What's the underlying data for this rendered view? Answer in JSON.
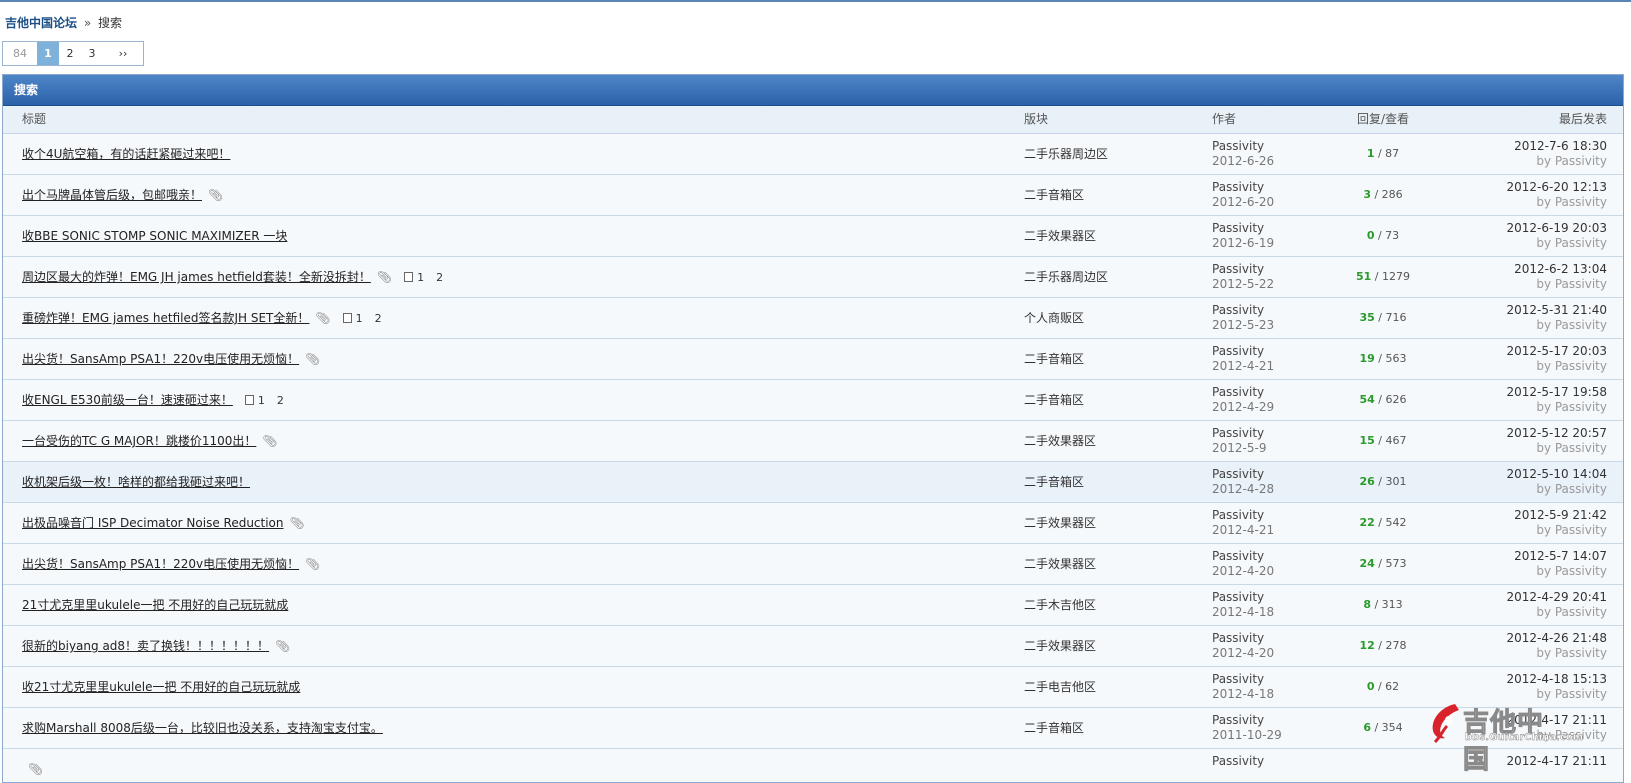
{
  "breadcrumb": {
    "home": "吉他中国论坛",
    "separator": "»",
    "current": "搜索"
  },
  "pager": {
    "total": "84",
    "current": "1",
    "pages": [
      "2",
      "3"
    ],
    "next": "››"
  },
  "panel": {
    "title": "搜索"
  },
  "columns": {
    "title": "标题",
    "forum": "版块",
    "author": "作者",
    "stats": "回复/查看",
    "last": "最后发表"
  },
  "rows": [
    {
      "title": "收个4U航空箱，有的话赶紧砸过来吧！",
      "forum": "二手乐器周边区",
      "author": "Passivity",
      "date": "2012-6-26",
      "replies": "1",
      "views": "/ 87",
      "last_date": "2012-7-6 18:30",
      "last_by": "by Passivity"
    },
    {
      "title": "出个马牌晶体管后级，包邮哦亲！",
      "attach": true,
      "forum": "二手音箱区",
      "author": "Passivity",
      "date": "2012-6-20",
      "replies": "3",
      "views": "/ 286",
      "last_date": "2012-6-20 12:13",
      "last_by": "by Passivity"
    },
    {
      "title": "收BBE SONIC STOMP SONIC MAXIMIZER 一块",
      "forum": "二手效果器区",
      "author": "Passivity",
      "date": "2012-6-19",
      "replies": "0",
      "views": "/ 73",
      "last_date": "2012-6-19 20:03",
      "last_by": "by Passivity"
    },
    {
      "title": "周边区最大的炸弹！EMG JH james hetfield套装！全新没拆封！",
      "attach": true,
      "pages": [
        "1",
        "2"
      ],
      "forum": "二手乐器周边区",
      "author": "Passivity",
      "date": "2012-5-22",
      "replies": "51",
      "views": "/ 1279",
      "last_date": "2012-6-2 13:04",
      "last_by": "by Passivity"
    },
    {
      "title": "重磅炸弹！EMG james hetfiled签名款JH SET全新！",
      "attach": true,
      "pages": [
        "1",
        "2"
      ],
      "forum": "个人商贩区",
      "author": "Passivity",
      "date": "2012-5-23",
      "replies": "35",
      "views": "/ 716",
      "last_date": "2012-5-31 21:40",
      "last_by": "by Passivity"
    },
    {
      "title": "出尖货！SansAmp PSA1！220v电压使用无烦恼！",
      "attach": true,
      "forum": "二手音箱区",
      "author": "Passivity",
      "date": "2012-4-21",
      "replies": "19",
      "views": "/ 563",
      "last_date": "2012-5-17 20:03",
      "last_by": "by Passivity"
    },
    {
      "title": "收ENGL E530前级一台！速速砸过来！",
      "pages": [
        "1",
        "2"
      ],
      "forum": "二手音箱区",
      "author": "Passivity",
      "date": "2012-4-29",
      "replies": "54",
      "views": "/ 626",
      "last_date": "2012-5-17 19:58",
      "last_by": "by Passivity"
    },
    {
      "title": "一台受伤的TC G MAJOR！跳楼价1100出！",
      "attach": true,
      "forum": "二手效果器区",
      "author": "Passivity",
      "date": "2012-5-9",
      "replies": "15",
      "views": "/ 467",
      "last_date": "2012-5-12 20:57",
      "last_by": "by Passivity"
    },
    {
      "title": "收机架后级一枚！啥样的都给我砸过来吧！",
      "forum": "二手音箱区",
      "author": "Passivity",
      "date": "2012-4-28",
      "replies": "26",
      "views": "/ 301",
      "last_date": "2012-5-10 14:04",
      "last_by": "by Passivity",
      "highlight": true
    },
    {
      "title": "出极品噪音门 ISP Decimator Noise Reduction",
      "attach": true,
      "forum": "二手效果器区",
      "author": "Passivity",
      "date": "2012-4-21",
      "replies": "22",
      "views": "/ 542",
      "last_date": "2012-5-9 21:42",
      "last_by": "by Passivity"
    },
    {
      "title": "出尖货！SansAmp PSA1！220v电压使用无烦恼！",
      "attach": true,
      "forum": "二手效果器区",
      "author": "Passivity",
      "date": "2012-4-20",
      "replies": "24",
      "views": "/ 573",
      "last_date": "2012-5-7 14:07",
      "last_by": "by Passivity"
    },
    {
      "title": "21寸尤克里里ukulele一把 不用好的自己玩玩就成",
      "forum": "二手木吉他区",
      "author": "Passivity",
      "date": "2012-4-18",
      "replies": "8",
      "views": "/ 313",
      "last_date": "2012-4-29 20:41",
      "last_by": "by Passivity"
    },
    {
      "title": "很新的biyang ad8！卖了换钱！！！！！！！",
      "attach": true,
      "forum": "二手效果器区",
      "author": "Passivity",
      "date": "2012-4-20",
      "replies": "12",
      "views": "/ 278",
      "last_date": "2012-4-26 21:48",
      "last_by": "by Passivity"
    },
    {
      "title": "收21寸尤克里里ukulele一把 不用好的自己玩玩就成",
      "forum": "二手电吉他区",
      "author": "Passivity",
      "date": "2012-4-18",
      "replies": "0",
      "views": "/ 62",
      "last_date": "2012-4-18 15:13",
      "last_by": "by Passivity"
    },
    {
      "title": "求购Marshall 8008后级一台，比较旧也没关系，支持淘宝支付宝。",
      "forum": "二手音箱区",
      "author": "Passivity",
      "date": "2011-10-29",
      "replies": "6",
      "views": "/ 354",
      "last_date": "2012-4-17 21:11",
      "last_by": "by Passivity"
    },
    {
      "title": "",
      "attach": true,
      "forum": "",
      "author": "Passivity",
      "date": "",
      "replies": "",
      "views": "",
      "last_date": "2012-4-17 21:11",
      "last_by": ""
    }
  ],
  "watermark": {
    "name": "吉他中国",
    "url": "bbs.GuitarChina.com"
  }
}
